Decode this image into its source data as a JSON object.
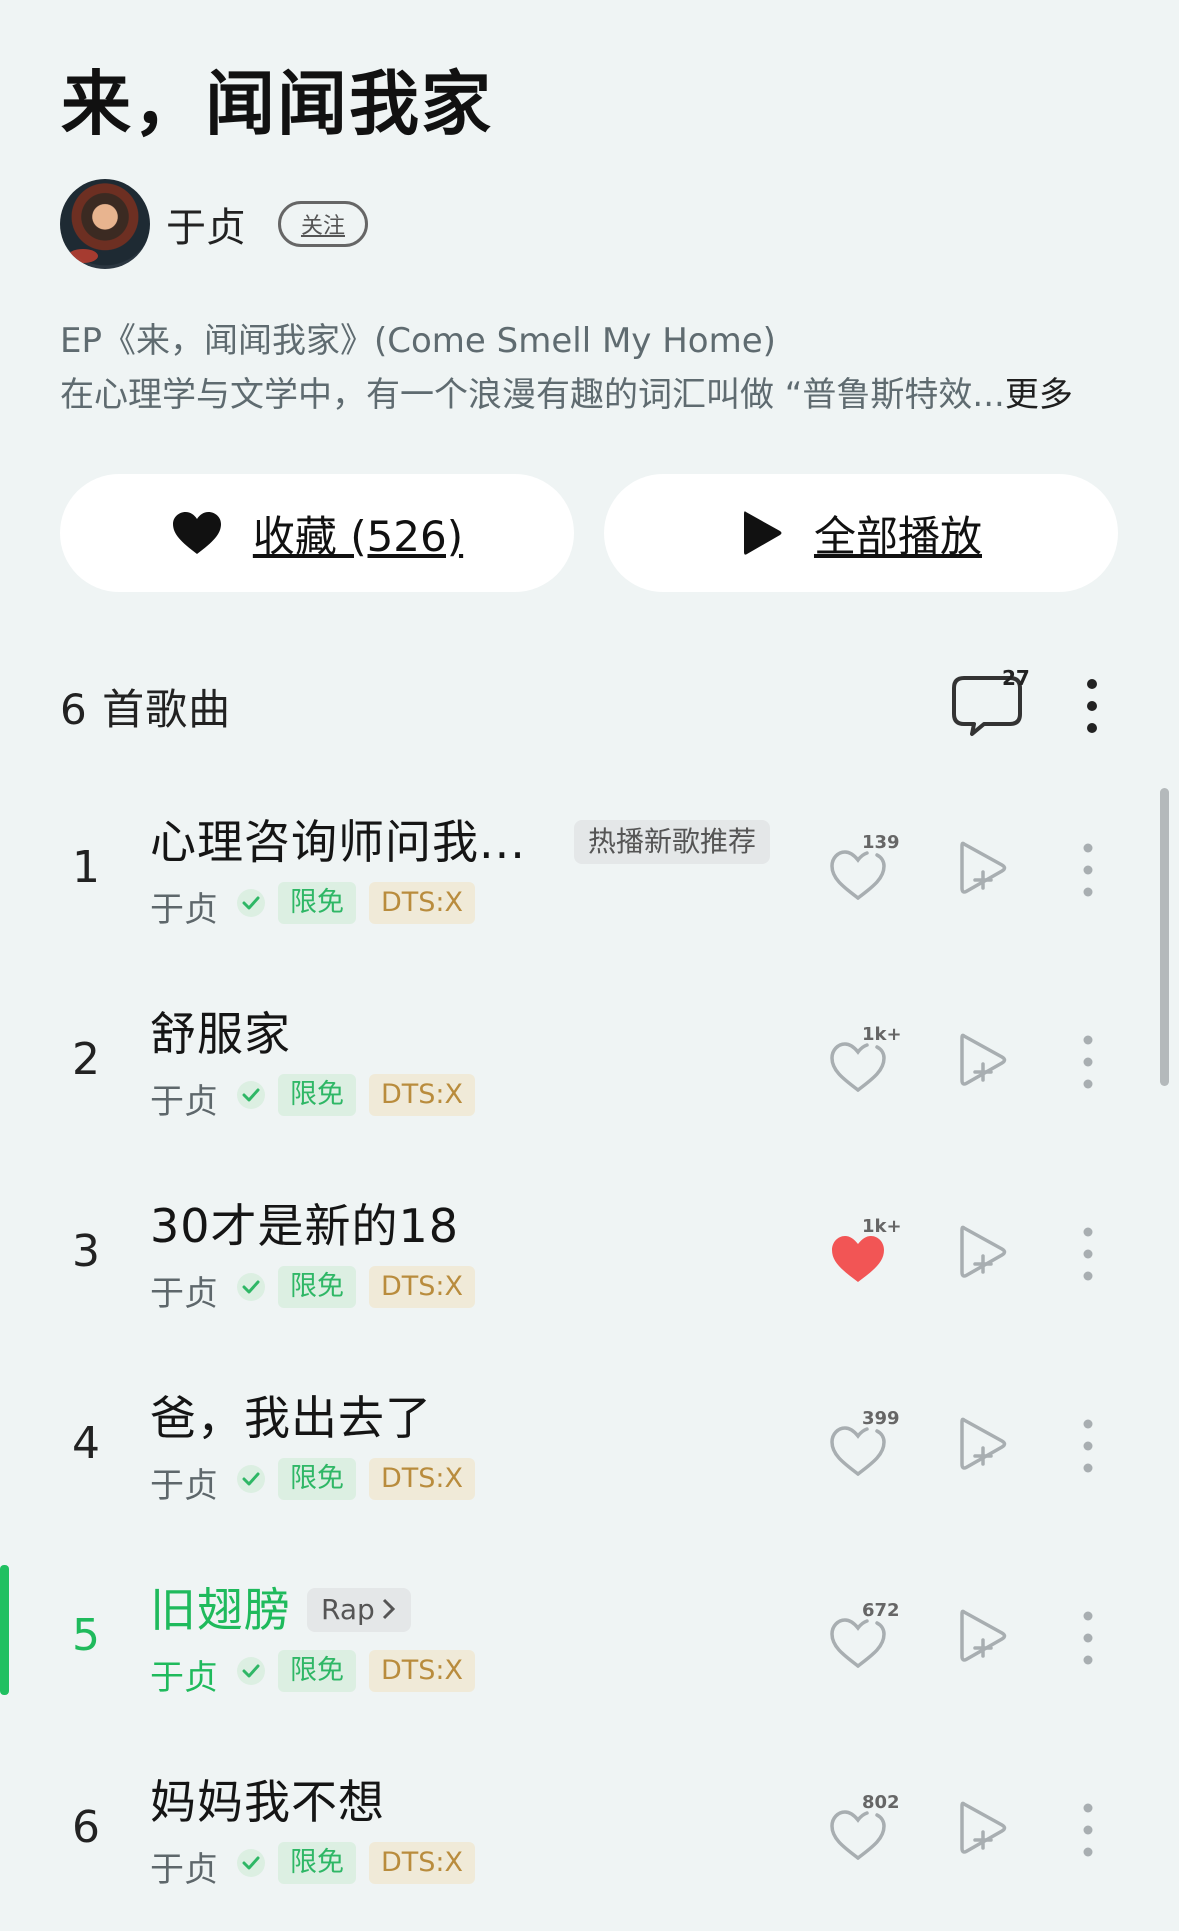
{
  "album": {
    "title": "来，闻闻我家",
    "artist": "于贞",
    "follow_label": "关注",
    "description_line1": "EP《来，闻闻我家》(Come Smell My Home)",
    "description_line2": "在心理学与文学中，有一个浪漫有趣的词汇叫做 “普鲁斯特效...",
    "more_label": "更多"
  },
  "actions": {
    "collect_label": "收藏 (526)",
    "play_all_label": "全部播放"
  },
  "list_header": {
    "song_count": "6 首歌曲",
    "comment_count": "27"
  },
  "songs": [
    {
      "index": "1",
      "title": "心理咨询师问我...",
      "tag": "热播新歌推荐",
      "artist": "于贞",
      "free": "限免",
      "dts": "DTS:X",
      "likes": "139",
      "liked": false,
      "playing": false
    },
    {
      "index": "2",
      "title": "舒服家",
      "tag": "",
      "artist": "于贞",
      "free": "限免",
      "dts": "DTS:X",
      "likes": "1k+",
      "liked": false,
      "playing": false
    },
    {
      "index": "3",
      "title": "30才是新的18",
      "tag": "",
      "artist": "于贞",
      "free": "限免",
      "dts": "DTS:X",
      "likes": "1k+",
      "liked": true,
      "playing": false
    },
    {
      "index": "4",
      "title": "爸，我出去了",
      "tag": "",
      "artist": "于贞",
      "free": "限免",
      "dts": "DTS:X",
      "likes": "399",
      "liked": false,
      "playing": false
    },
    {
      "index": "5",
      "title": "旧翅膀",
      "tag": "Rap",
      "artist": "于贞",
      "free": "限免",
      "dts": "DTS:X",
      "likes": "672",
      "liked": false,
      "playing": true
    },
    {
      "index": "6",
      "title": "妈妈我不想",
      "tag": "",
      "artist": "于贞",
      "free": "限免",
      "dts": "DTS:X",
      "likes": "802",
      "liked": false,
      "playing": false
    }
  ],
  "colors": {
    "background": "#eff4f4",
    "accent_green": "#1fba5c",
    "liked_red": "#f25555",
    "dts_gold": "#b98c3d"
  },
  "icons": [
    "heart-icon",
    "play-icon",
    "comment-icon",
    "more-vertical-icon",
    "verified-check-icon",
    "add-to-playlist-icon",
    "chevron-right-icon"
  ]
}
